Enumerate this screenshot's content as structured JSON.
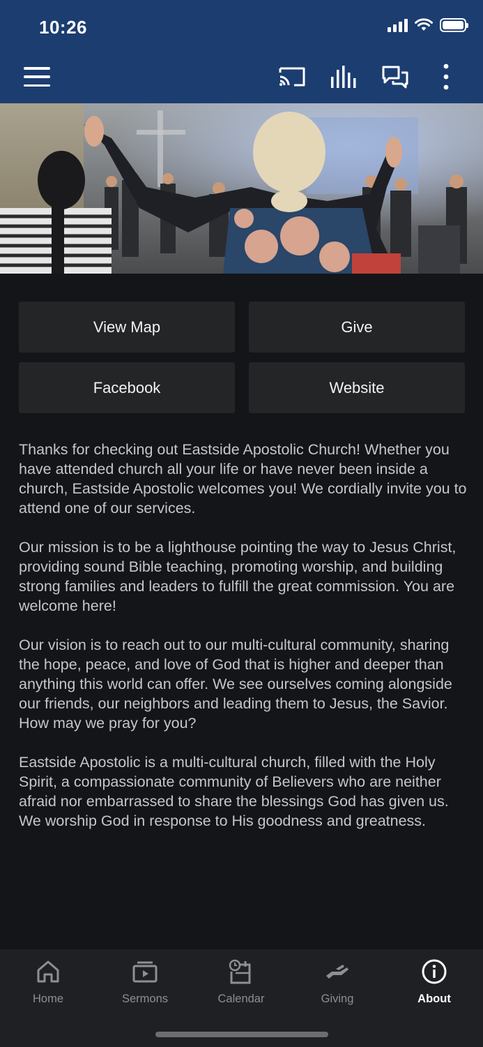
{
  "status_bar": {
    "time": "10:26"
  },
  "header": {
    "icons": [
      "menu-icon",
      "cast-icon",
      "audio-bars-icon",
      "chat-icon",
      "more-vertical-icon"
    ],
    "background": "#1c3d70"
  },
  "hero": {
    "description_icon": "worship-photo"
  },
  "actions": {
    "view_map": "View Map",
    "give": "Give",
    "facebook": "Facebook",
    "website": "Website"
  },
  "about": {
    "paragraphs": [
      "Thanks for checking out Eastside Apostolic Church! Whether you have attended church all your life or have never been inside a church, Eastside Apostolic welcomes you! We cordially invite you to attend one of our services.",
      "Our mission is to be a lighthouse pointing the way to Jesus Christ, providing sound Bible teaching, promoting worship, and building strong families and leaders to fulfill the great commission. You are welcome here!",
      "Our vision is to reach out to our multi-cultural community, sharing the hope, peace, and love of God that is higher and deeper than anything this world can offer. We see ourselves coming alongside our friends, our neighbors and leading them to Jesus, the Savior. How may we pray for you?",
      "Eastside Apostolic is a multi-cultural church, filled with the Holy Spirit, a compassionate community of Believers who are neither afraid nor embarrassed to share the blessings God has given us. We worship God in response to His goodness and greatness."
    ]
  },
  "bottom_nav": {
    "items": [
      {
        "label": "Home",
        "icon": "home-icon"
      },
      {
        "label": "Sermons",
        "icon": "play-media-icon"
      },
      {
        "label": "Calendar",
        "icon": "calendar-clock-icon"
      },
      {
        "label": "Giving",
        "icon": "giving-hand-icon"
      },
      {
        "label": "About",
        "icon": "info-icon",
        "active": true
      }
    ]
  },
  "colors": {
    "accent": "#1c3d70",
    "background": "#141518",
    "button": "#242527",
    "nav_bg": "#1f2023"
  }
}
